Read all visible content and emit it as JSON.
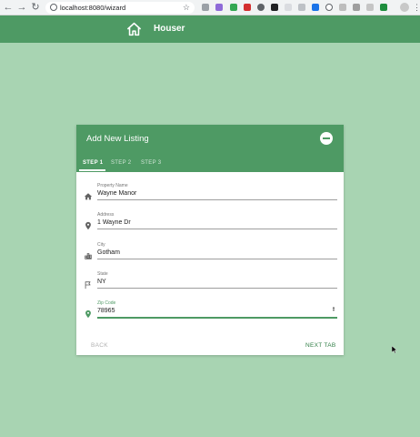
{
  "browser": {
    "url": "localhost:8080/wizard",
    "back_icon": "arrow-left",
    "forward_icon": "arrow-right",
    "reload_icon": "reload",
    "bookmark_icon": "star-outline"
  },
  "app": {
    "brand": "Houser",
    "logo_icon": "home-outline",
    "colors": {
      "primary": "#4e9a64",
      "background": "#a8d4b2"
    }
  },
  "card": {
    "title": "Add New Listing",
    "collapse_icon": "minus-circle",
    "tabs": [
      {
        "label": "STEP 1",
        "active": true
      },
      {
        "label": "STEP 2",
        "active": false
      },
      {
        "label": "STEP 3",
        "active": false
      }
    ],
    "fields": [
      {
        "label": "Property Name",
        "value": "Wayne Manor",
        "icon": "home-icon"
      },
      {
        "label": "Address",
        "value": "1 Wayne Dr",
        "icon": "map-marker-icon"
      },
      {
        "label": "City",
        "value": "Gotham",
        "icon": "city-icon"
      },
      {
        "label": "State",
        "value": "NY",
        "icon": "flag-icon"
      },
      {
        "label": "Zip Code",
        "value": "78965",
        "icon": "map-marker-icon"
      }
    ],
    "back_label": "BACK",
    "next_label": "NEXT TAB"
  }
}
